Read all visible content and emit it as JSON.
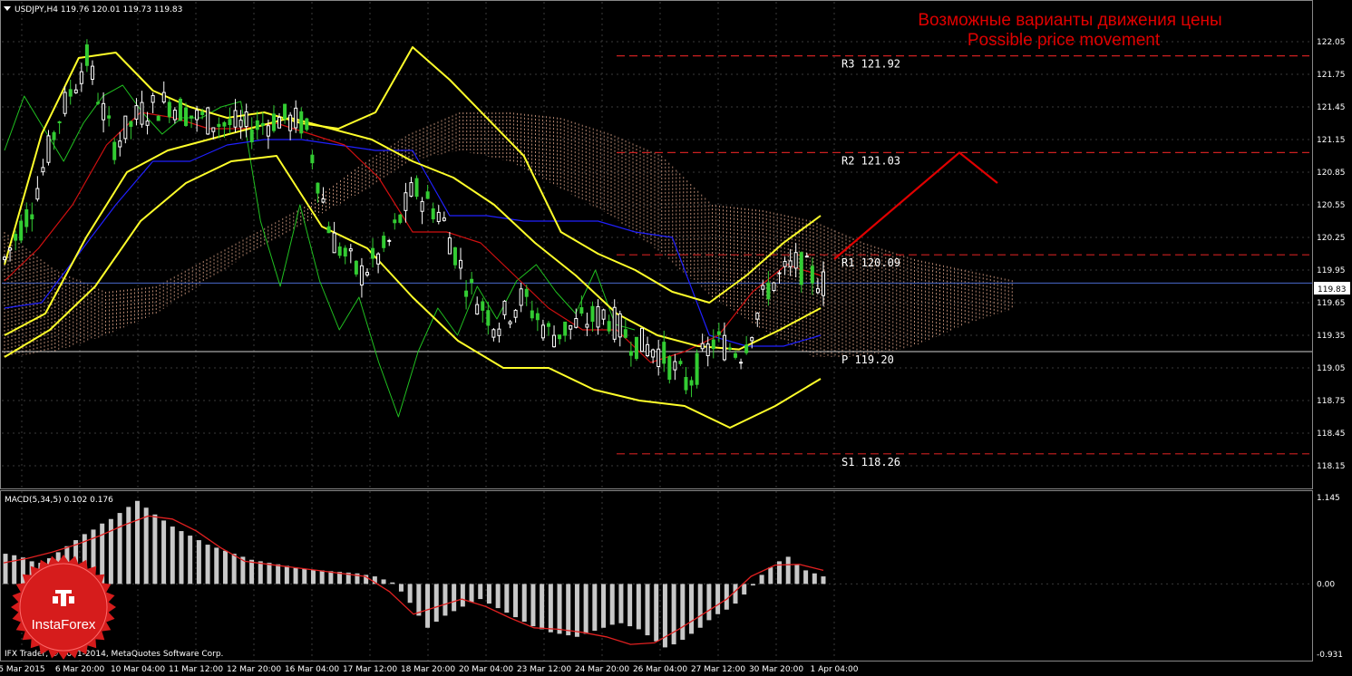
{
  "header": {
    "symbol_info": "USDJPY,H4  119.76 120.01 119.73 119.83"
  },
  "annotation": {
    "title_ru": "Возможные варианты движения цены",
    "title_en": "Possible price movement"
  },
  "price_tag": "119.83",
  "macd_label": "MACD(5,34,5) 0.102 0.176",
  "copyright": "IFX Trader, © 2001-2014, MetaQuotes Software Corp.",
  "badge": {
    "text": "InstaForex"
  },
  "colors": {
    "background": "#000000",
    "grid": "#3a3a3a",
    "bollinger": "#ffff2a",
    "kijun": "#2020ff",
    "tenkan": "#d01010",
    "chikou": "#20c020",
    "cloud": "#d09a80",
    "candle_bull": "#ffffff",
    "candle_bear": "#33cc33",
    "levels": "#cc2020",
    "forecast": "#e00000",
    "macd_hist": "#c8c8c8",
    "macd_signal": "#e02020",
    "badge": "#d61c1c"
  },
  "chart_data": [
    {
      "type": "line",
      "name": "price",
      "x_labels": [
        "5 Mar 2015",
        "6 Mar 20:00",
        "10 Mar 04:00",
        "11 Mar 12:00",
        "12 Mar 20:00",
        "16 Mar 04:00",
        "17 Mar 12:00",
        "18 Mar 20:00",
        "20 Mar 04:00",
        "23 Mar 12:00",
        "24 Mar 20:00",
        "26 Mar 04:00",
        "27 Mar 12:00",
        "30 Mar 20:00",
        "1 Apr 04:00"
      ],
      "y_ticks": [
        "122.05",
        "121.75",
        "121.45",
        "121.15",
        "120.85",
        "120.55",
        "120.25",
        "119.95",
        "119.65",
        "119.35",
        "119.05",
        "118.75",
        "118.45",
        "118.15"
      ],
      "ylim": [
        118.05,
        122.15
      ],
      "close": [
        120.05,
        120.55,
        121.35,
        121.9,
        121.1,
        121.4,
        121.5,
        121.35,
        121.3,
        121.25,
        121.35,
        121.3,
        120.25,
        119.9,
        120.15,
        120.7,
        120.45,
        119.8,
        119.45,
        119.7,
        119.35,
        119.45,
        119.55,
        119.3,
        119.2,
        118.9,
        119.3,
        119.2,
        119.8,
        120.0,
        119.83
      ],
      "bollinger_upper": [
        120.0,
        121.2,
        121.9,
        121.95,
        121.6,
        121.45,
        121.35,
        121.4,
        121.3,
        121.25,
        121.4,
        122.0,
        121.7,
        121.35,
        121.0,
        120.3,
        120.1,
        119.95,
        119.75,
        119.65,
        119.9,
        120.2,
        120.45
      ],
      "bollinger_middle": [
        119.35,
        119.55,
        120.25,
        120.85,
        121.05,
        121.15,
        121.25,
        121.35,
        121.25,
        121.15,
        120.95,
        120.8,
        120.55,
        120.2,
        119.9,
        119.55,
        119.35,
        119.25,
        119.22,
        119.4,
        119.6
      ],
      "bollinger_lower": [
        119.15,
        119.4,
        119.8,
        120.4,
        120.75,
        120.95,
        121.0,
        120.35,
        120.15,
        119.7,
        119.3,
        119.05,
        119.05,
        118.85,
        118.75,
        118.7,
        118.5,
        118.7,
        118.95
      ],
      "levels": [
        {
          "name": "R3",
          "label": "R3  121.92",
          "value": 121.92
        },
        {
          "name": "R2",
          "label": "R2  121.03",
          "value": 121.03
        },
        {
          "name": "R1",
          "label": "R1  120.09",
          "value": 120.09
        },
        {
          "name": "P",
          "label": "P  119.20",
          "value": 119.2
        },
        {
          "name": "S1",
          "label": "S1  118.26",
          "value": 118.26
        }
      ],
      "forecast_path": [
        [
          120.05,
          "1 Apr"
        ],
        [
          121.03,
          "peak"
        ],
        [
          120.75,
          "end"
        ]
      ]
    },
    {
      "type": "bar",
      "name": "MACD(5,34,5)",
      "ylim": [
        -0.931,
        1.145
      ],
      "y_ticks": [
        "1.145",
        "0.00",
        "-0.931"
      ],
      "histogram": [
        0.4,
        0.38,
        0.35,
        0.3,
        0.28,
        0.34,
        0.42,
        0.5,
        0.58,
        0.66,
        0.72,
        0.8,
        0.86,
        0.94,
        1.02,
        1.1,
        1.01,
        0.92,
        0.84,
        0.76,
        0.7,
        0.64,
        0.58,
        0.52,
        0.48,
        0.44,
        0.4,
        0.36,
        0.32,
        0.3,
        0.28,
        0.26,
        0.24,
        0.22,
        0.2,
        0.19,
        0.18,
        0.17,
        0.16,
        0.15,
        0.14,
        0.12,
        0.1,
        0.06,
        0.02,
        -0.1,
        -0.25,
        -0.42,
        -0.58,
        -0.5,
        -0.42,
        -0.36,
        -0.3,
        -0.24,
        -0.2,
        -0.26,
        -0.32,
        -0.38,
        -0.44,
        -0.5,
        -0.56,
        -0.6,
        -0.64,
        -0.66,
        -0.68,
        -0.7,
        -0.66,
        -0.62,
        -0.58,
        -0.54,
        -0.52,
        -0.56,
        -0.6,
        -0.68,
        -0.76,
        -0.84,
        -0.8,
        -0.74,
        -0.66,
        -0.58,
        -0.48,
        -0.4,
        -0.34,
        -0.26,
        -0.14,
        -0.02,
        0.12,
        0.22,
        0.3,
        0.36,
        0.26,
        0.18,
        0.14,
        0.1
      ],
      "signal": [
        0.28,
        0.34,
        0.42,
        0.52,
        0.64,
        0.78,
        0.9,
        0.86,
        0.7,
        0.48,
        0.3,
        0.26,
        0.22,
        0.18,
        0.14,
        0.1,
        -0.1,
        -0.4,
        -0.3,
        -0.2,
        -0.3,
        -0.45,
        -0.58,
        -0.6,
        -0.64,
        -0.7,
        -0.8,
        -0.78,
        -0.6,
        -0.4,
        -0.2,
        0.1,
        0.25,
        0.26,
        0.18
      ]
    }
  ]
}
